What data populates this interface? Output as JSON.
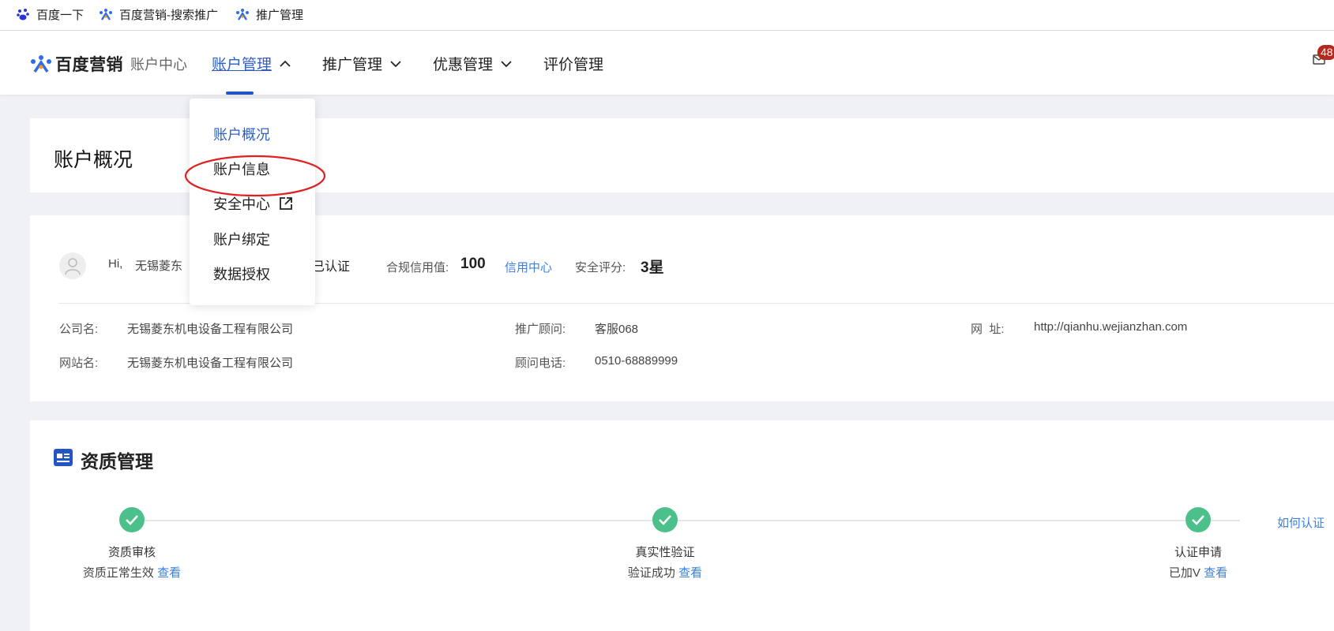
{
  "bookmarks": [
    {
      "label": "百度一下",
      "icon": "baidu-paw-icon"
    },
    {
      "label": "百度营销-搜索推广",
      "icon": "baidu-marketing-icon"
    },
    {
      "label": "推广管理",
      "icon": "baidu-marketing-icon"
    }
  ],
  "header": {
    "brand": "百度营销",
    "subtitle": "账户中心",
    "nav": [
      {
        "label": "账户管理",
        "active": true,
        "expanded": true
      },
      {
        "label": "推广管理"
      },
      {
        "label": "优惠管理"
      },
      {
        "label": "评价管理"
      }
    ],
    "message_badge": "48"
  },
  "dropdown": {
    "items": [
      {
        "label": "账户概况",
        "active": true
      },
      {
        "label": "账户信息",
        "highlighted": true
      },
      {
        "label": "安全中心",
        "icon": "external-link-icon"
      },
      {
        "label": "账户绑定"
      },
      {
        "label": "数据授权"
      }
    ]
  },
  "overview": {
    "title": "账户概况"
  },
  "account": {
    "greeting": "Hi,",
    "username": "无锡菱东",
    "verified_text": "已认证",
    "credit_label": "合规信用值:",
    "credit_value": "100",
    "credit_link": "信用中心",
    "security_label": "安全评分:",
    "security_value": "3星",
    "company_label": "公司名:",
    "company_value": "无锡菱东机电设备工程有限公司",
    "site_label": "网站名:",
    "site_value": "无锡菱东机电设备工程有限公司",
    "advisor_label": "推广顾问:",
    "advisor_value": "客服068",
    "phone_label": "顾问电话:",
    "phone_value": "0510-68889999",
    "url_label": "网  址:",
    "url_value": "http://qianhu.wejianzhan.com"
  },
  "qualification": {
    "title": "资质管理",
    "how_link": "如何认证",
    "view_link": "查看",
    "steps": [
      {
        "name": "资质审核",
        "status": "资质正常生效"
      },
      {
        "name": "真实性验证",
        "status": "验证成功"
      },
      {
        "name": "认证申请",
        "status": "已加V"
      }
    ]
  },
  "colors": {
    "accent": "#2f5ec5",
    "link": "#3d7fe0",
    "success": "#4cc08a",
    "badge": "#b4281d",
    "annotation": "#e02020"
  }
}
